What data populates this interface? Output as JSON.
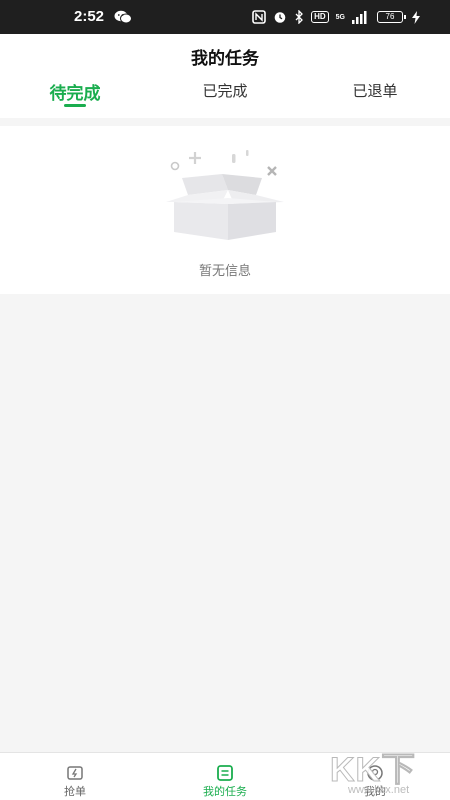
{
  "status_bar": {
    "time": "2:52",
    "battery": "76",
    "network_label": "5G",
    "hd_label": "HD",
    "icons": [
      "wechat-icon",
      "nfc-icon",
      "alarm-icon",
      "bluetooth-icon",
      "hd-icon",
      "signal-icon",
      "battery-icon",
      "charging-icon"
    ]
  },
  "header": {
    "title": "我的任务"
  },
  "tabs": [
    {
      "label": "待完成",
      "active": true
    },
    {
      "label": "已完成",
      "active": false
    },
    {
      "label": "已退单",
      "active": false
    }
  ],
  "empty_state": {
    "message": "暂无信息",
    "icon": "empty-box-icon"
  },
  "tabbar": [
    {
      "label": "抢单",
      "icon": "grab-order-icon",
      "active": false
    },
    {
      "label": "我的任务",
      "icon": "task-list-icon",
      "active": true
    },
    {
      "label": "我的",
      "icon": "profile-icon",
      "active": false
    }
  ],
  "watermark": {
    "main": "KK下载",
    "sub": "www.kkx.net"
  },
  "colors": {
    "accent": "#1aad4e",
    "background": "#f5f5f5",
    "status_bar": "#1f1f1f"
  }
}
